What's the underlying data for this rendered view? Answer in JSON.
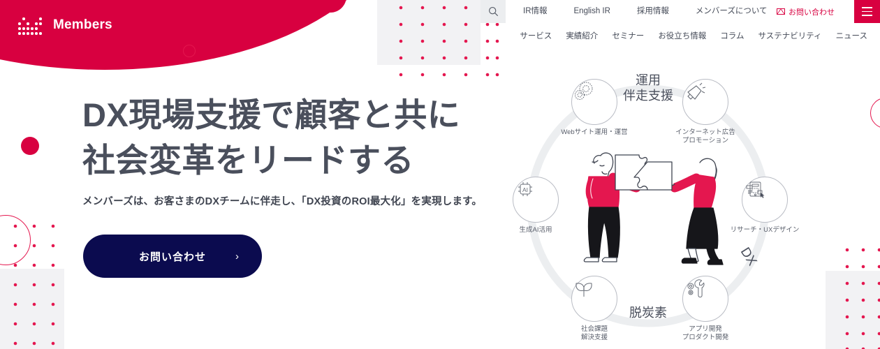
{
  "brand": {
    "name": "Members",
    "red": "#d80040",
    "navy": "#0b0b4f",
    "text_gray": "#4a4f5c"
  },
  "header": {
    "search_icon": "search-icon",
    "nav_primary": [
      {
        "label": "IR情報"
      },
      {
        "label": "English IR"
      },
      {
        "label": "採用情報"
      },
      {
        "label": "メンバーズについて"
      }
    ],
    "contact": {
      "label": "お問い合わせ",
      "icon": "mail-icon"
    },
    "menu_icon": "hamburger-menu-icon",
    "nav_secondary": [
      {
        "label": "サービス"
      },
      {
        "label": "実績紹介"
      },
      {
        "label": "セミナー"
      },
      {
        "label": "お役立ち情報"
      },
      {
        "label": "コラム"
      },
      {
        "label": "サステナビリティ"
      },
      {
        "label": "ニュース"
      }
    ]
  },
  "hero": {
    "heading": "DX現場支援で顧客と共に\n社会変革をリードする",
    "subheading": "メンバーズは、お客さまのDXチームに伴走し、「DX投資のROI最大化」を実現します。",
    "cta_label": "お問い合わせ",
    "cta_chevron": "›"
  },
  "diagram": {
    "arc_top_label": "運用\n伴走支援",
    "arc_bottom_label": "脱炭素",
    "arc_right_label": "DX",
    "center_illustration": "two-people-puzzle-illustration",
    "nodes": [
      {
        "id": "website",
        "icon": "gears-icon",
        "caption": "Webサイト運用・運営"
      },
      {
        "id": "ads",
        "icon": "megaphone-icon",
        "caption": "インターネット広告\nプロモーション"
      },
      {
        "id": "ai",
        "icon": "ai-chip-icon",
        "caption": "生成AI活用"
      },
      {
        "id": "research",
        "icon": "wireframe-icon",
        "caption": "リサーチ・UXデザイン"
      },
      {
        "id": "social",
        "icon": "leaf-icon",
        "caption": "社会課題\n解決支援"
      },
      {
        "id": "app",
        "icon": "wrench-icon",
        "caption": "アプリ開発\nプロダクト開発"
      }
    ]
  }
}
